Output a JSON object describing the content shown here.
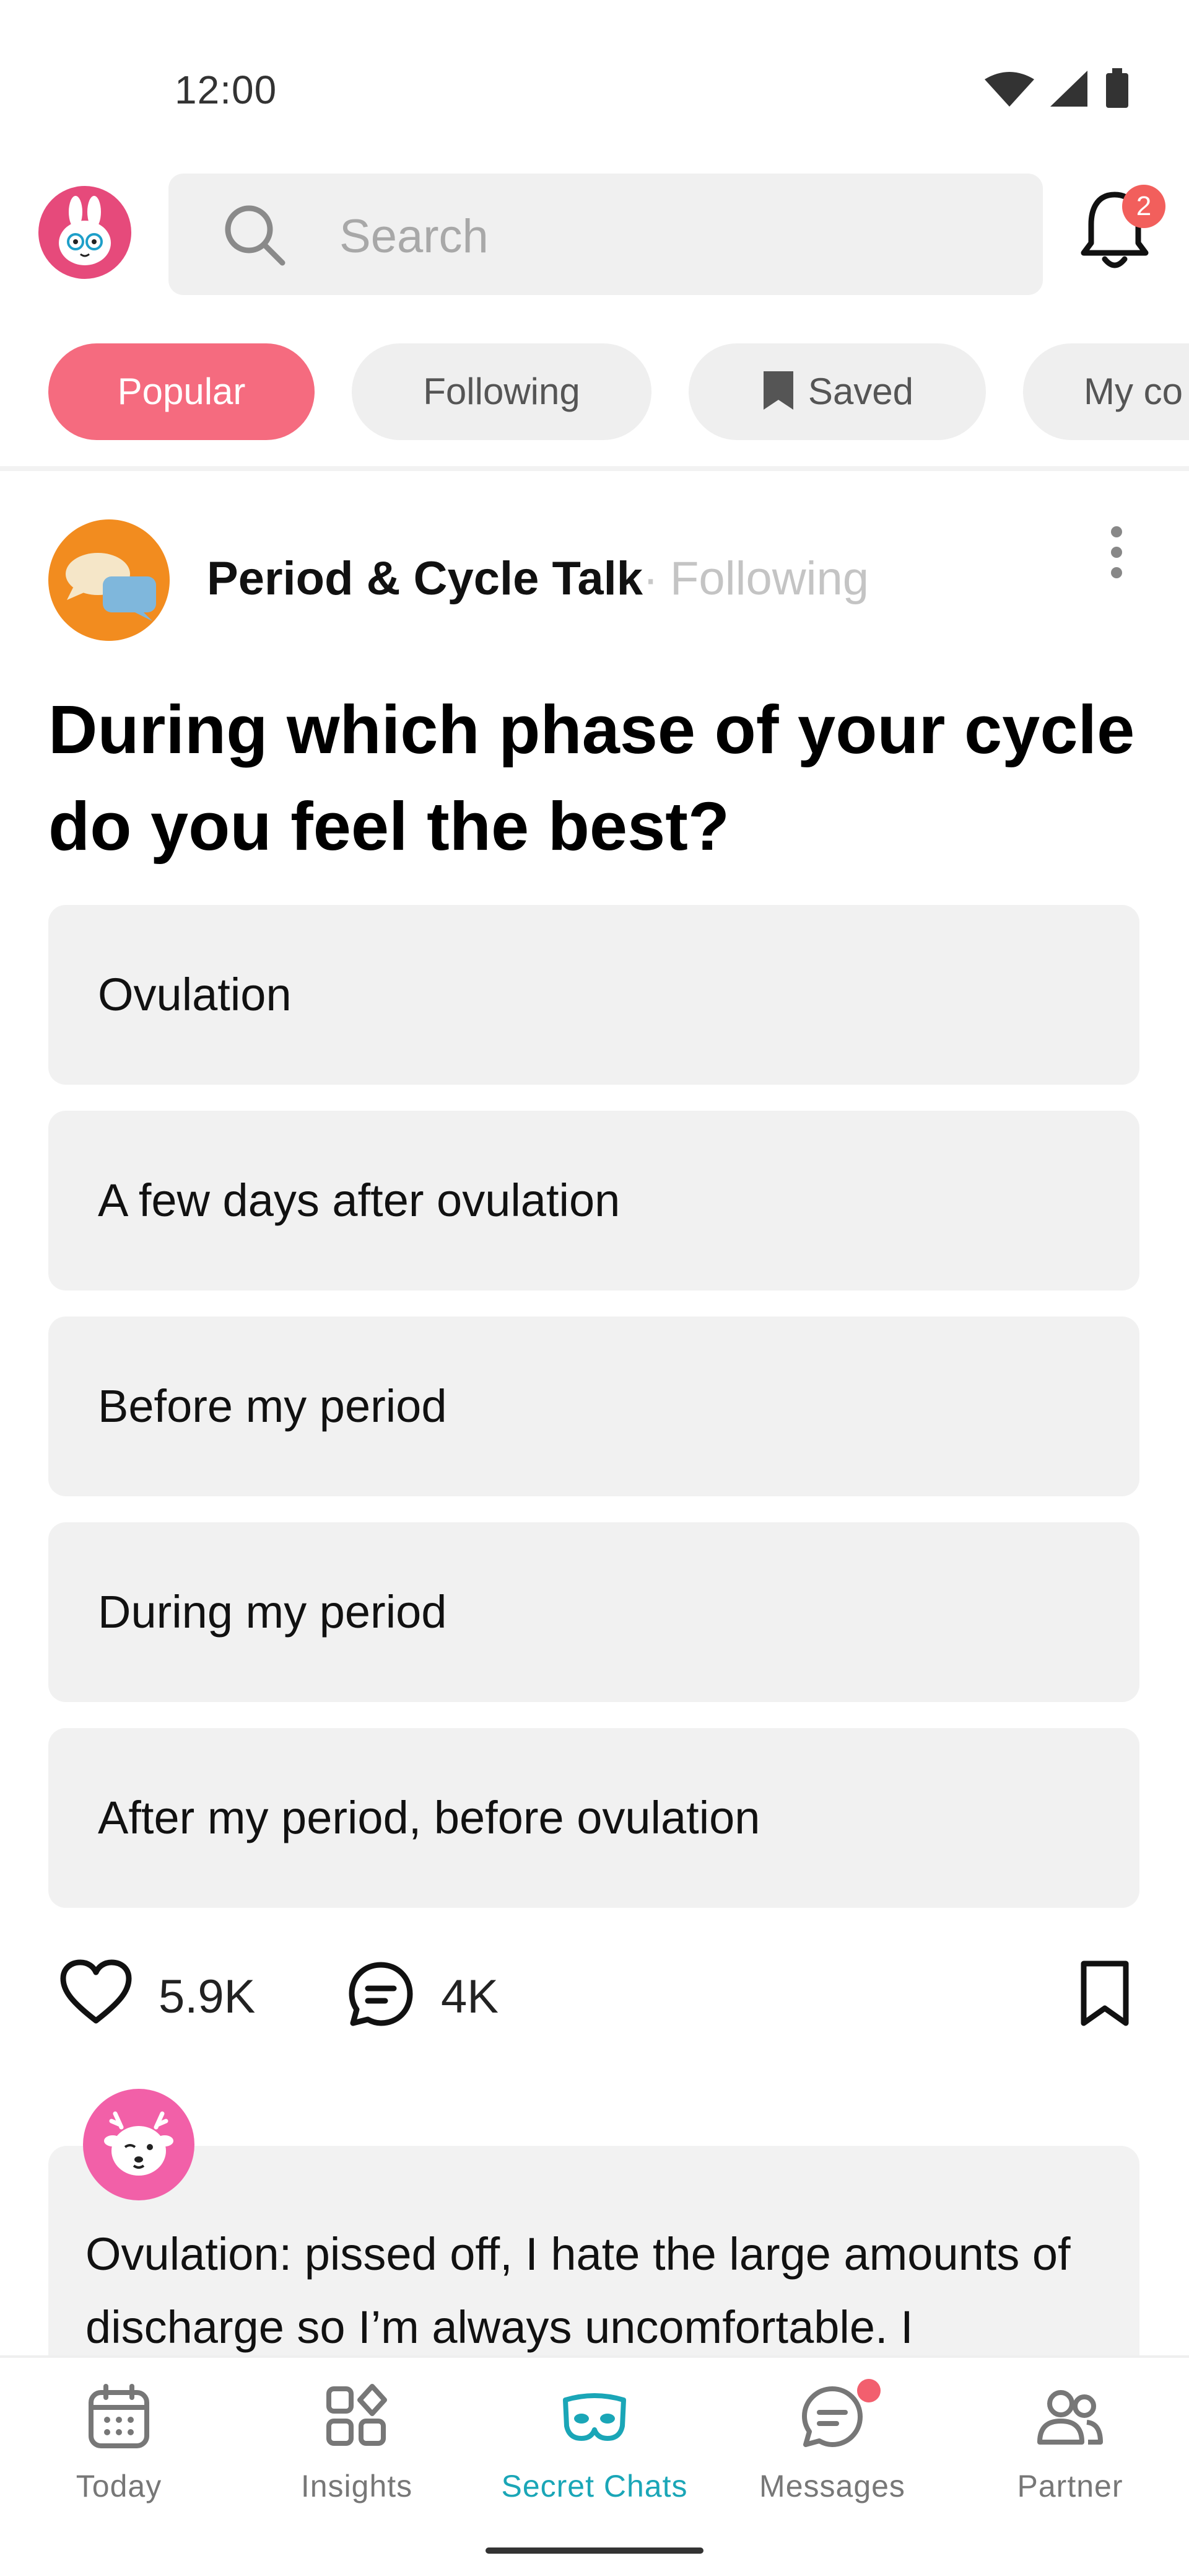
{
  "status_bar": {
    "time": "12:00",
    "icons": [
      "wifi-icon",
      "cellular-icon",
      "battery-icon"
    ]
  },
  "header": {
    "search_placeholder": "Search",
    "notification_count": "2",
    "colors": {
      "avatar_bg": "#e64a7b",
      "badge": "#f25f5c"
    }
  },
  "filters": {
    "items": [
      "Popular",
      "Following",
      "Saved",
      "My co"
    ],
    "selected": "Popular",
    "colors": {
      "active": "#f56b7f"
    }
  },
  "post": {
    "group_name": "Period & Cycle Talk",
    "separator": "·",
    "follow_status": "Following",
    "question": "During which phase of your cycle do you feel the best?",
    "options": [
      "Ovulation",
      "A few days after ovulation",
      "Before my period",
      "During my period",
      "After my period, before ovulation"
    ],
    "likes": "5.9K",
    "comments": "4K"
  },
  "comment_preview": {
    "text": "Ovulation: pissed off, I hate the large amounts of discharge so I’m always uncomfortable. I"
  },
  "bottom_nav": {
    "items": [
      "Today",
      "Insights",
      "Secret Chats",
      "Messages",
      "Partner"
    ],
    "active": "Secret Chats",
    "colors": {
      "active": "#1aa6b7",
      "inactive": "#777777"
    }
  }
}
